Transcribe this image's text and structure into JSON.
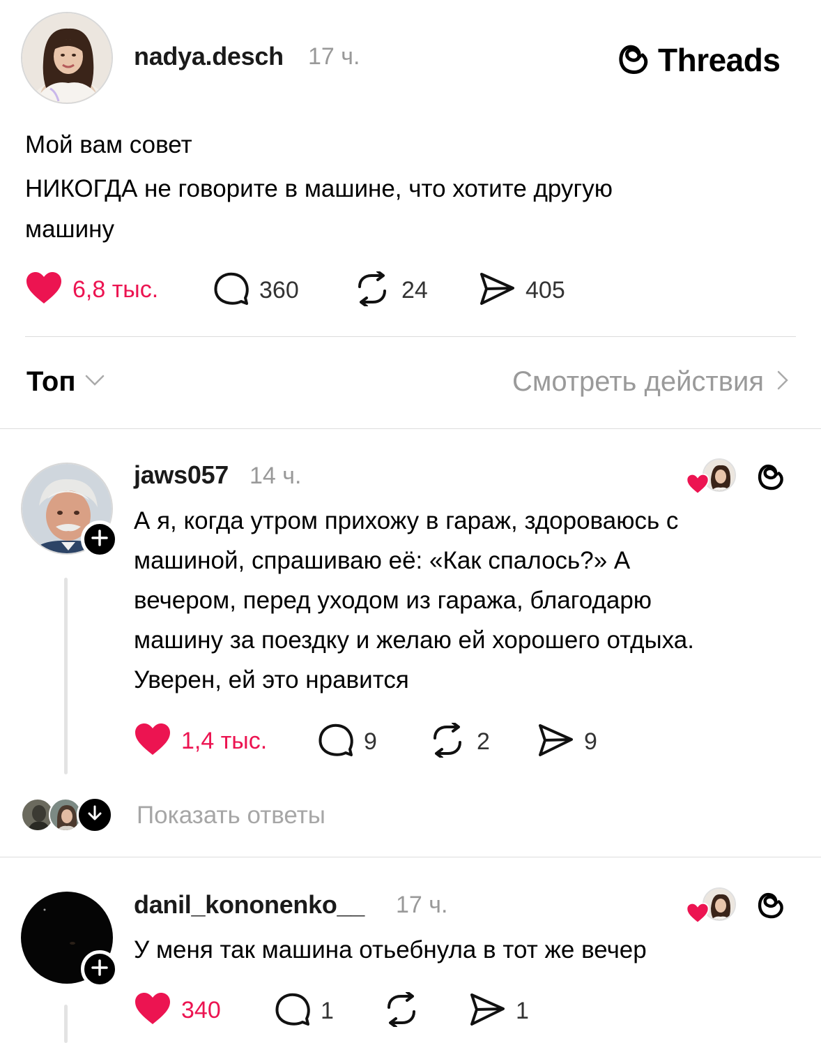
{
  "brand": {
    "label": "Threads",
    "icon": "threads-logo-icon"
  },
  "post": {
    "username": "nadya.desch",
    "time": "17 ч.",
    "lines": [
      "Мой вам совет",
      "НИКОГДА не говорите в машине, что хотите другую",
      "машину"
    ],
    "likes": "6,8 тыс.",
    "comments": "360",
    "reposts": "24",
    "shares": "405",
    "liked": true
  },
  "sort": {
    "label": "Топ"
  },
  "activity": {
    "label": "Смотреть действия"
  },
  "replies": [
    {
      "username": "jaws057",
      "time": "14 ч.",
      "lines": [
        "А я, когда утром прихожу в гараж, здороваюсь с",
        "машиной, спрашиваю её: «Как спалось?» А",
        "вечером, перед уходом из гаража, благодарю",
        "машину за поездку и желаю ей хорошего отдыха.",
        "Уверен, ей это нравится"
      ],
      "likes": "1,4 тыс.",
      "comments": "9",
      "reposts": "2",
      "shares": "9"
    },
    {
      "username": "danil_kononenko__",
      "time": "17 ч.",
      "lines": [
        "У меня так машина отьебнула в тот же вечер"
      ],
      "likes": "340",
      "comments": "1",
      "reposts": "",
      "shares": "1"
    }
  ],
  "show_replies": {
    "label": "Показать ответы"
  },
  "colors": {
    "like": "#ec1451",
    "muted": "#999999",
    "divider": "#dcdcdc"
  }
}
